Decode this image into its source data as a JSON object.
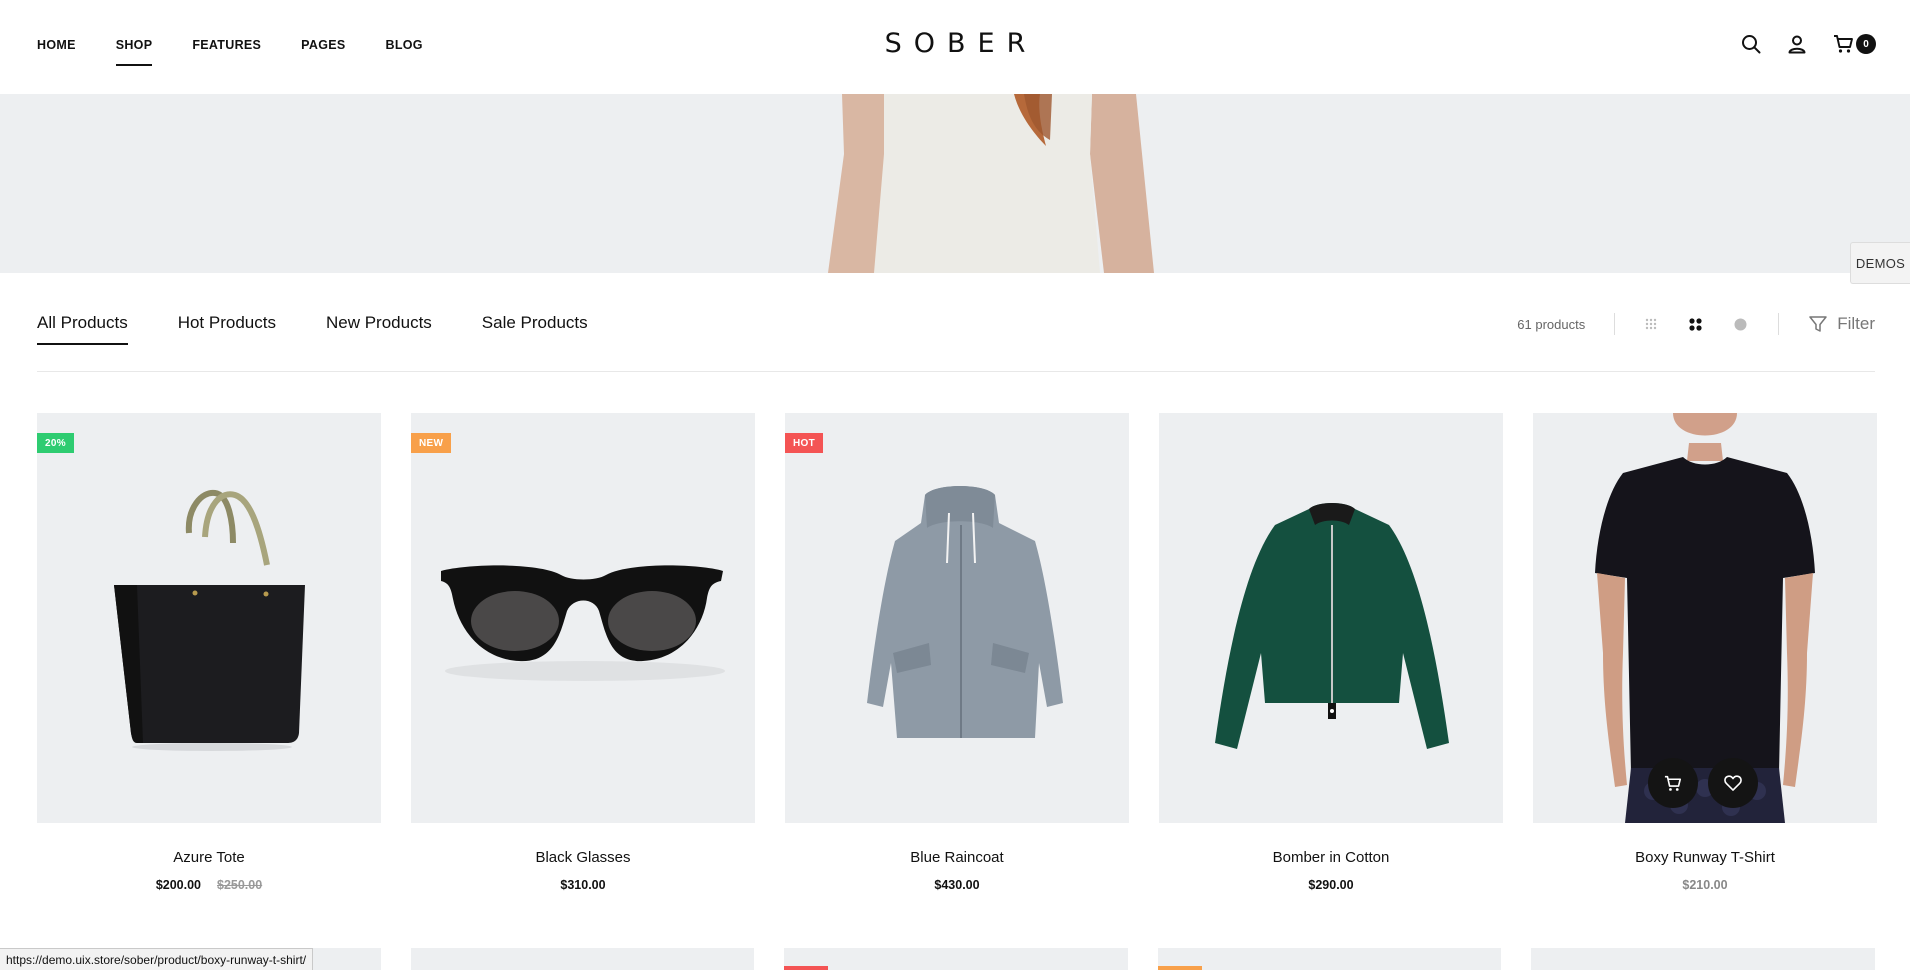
{
  "header": {
    "nav": [
      "HOME",
      "SHOP",
      "FEATURES",
      "PAGES",
      "BLOG"
    ],
    "active_nav": "SHOP",
    "logo": "SOBER",
    "cart_count": "0",
    "icons": [
      "search-icon",
      "account-icon",
      "cart-icon"
    ]
  },
  "demos_label": "DEMOS",
  "toolbar": {
    "tabs": [
      "All Products",
      "Hot Products",
      "New Products",
      "Sale Products"
    ],
    "active_tab": "All Products",
    "count_text": "61 products",
    "filter_label": "Filter",
    "view_icons": [
      "grid-small-icon",
      "grid-large-icon",
      "list-view-icon",
      "filter-icon"
    ]
  },
  "products": [
    {
      "name": "Azure Tote",
      "price": "$200.00",
      "old_price": "$250.00",
      "badge": "20%",
      "badge_color": "#2ecc71"
    },
    {
      "name": "Black Glasses",
      "price": "$310.00",
      "badge": "NEW",
      "badge_color": "#f8a04a"
    },
    {
      "name": "Blue Raincoat",
      "price": "$430.00",
      "badge": "HOT",
      "badge_color": "#f45454"
    },
    {
      "name": "Bomber in Cotton",
      "price": "$290.00"
    },
    {
      "name": "Boxy Runway T-Shirt",
      "price": "$210.00"
    }
  ],
  "row2_badge_colors": [
    "#f45454",
    "#f8a04a"
  ],
  "status_url": "https://demo.uix.store/sober/product/boxy-runway-t-shirt/"
}
